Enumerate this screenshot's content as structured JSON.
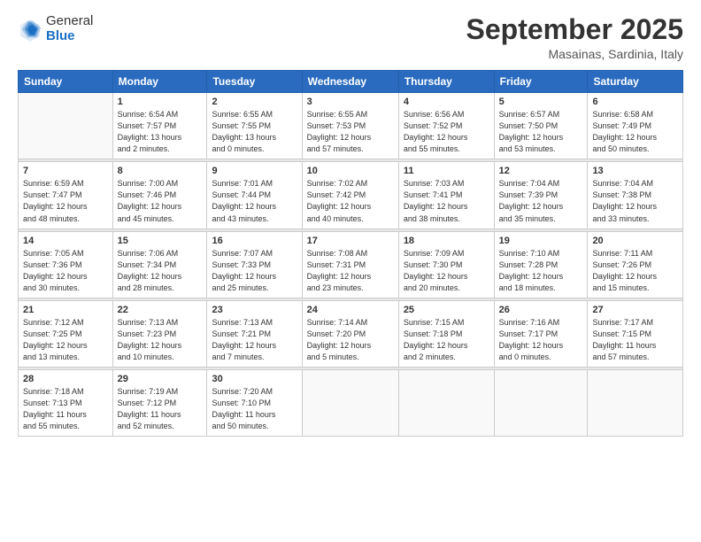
{
  "logo": {
    "general": "General",
    "blue": "Blue"
  },
  "header": {
    "month_title": "September 2025",
    "subtitle": "Masainas, Sardinia, Italy"
  },
  "weekdays": [
    "Sunday",
    "Monday",
    "Tuesday",
    "Wednesday",
    "Thursday",
    "Friday",
    "Saturday"
  ],
  "weeks": [
    [
      {
        "day": "",
        "info": ""
      },
      {
        "day": "1",
        "info": "Sunrise: 6:54 AM\nSunset: 7:57 PM\nDaylight: 13 hours\nand 2 minutes."
      },
      {
        "day": "2",
        "info": "Sunrise: 6:55 AM\nSunset: 7:55 PM\nDaylight: 13 hours\nand 0 minutes."
      },
      {
        "day": "3",
        "info": "Sunrise: 6:55 AM\nSunset: 7:53 PM\nDaylight: 12 hours\nand 57 minutes."
      },
      {
        "day": "4",
        "info": "Sunrise: 6:56 AM\nSunset: 7:52 PM\nDaylight: 12 hours\nand 55 minutes."
      },
      {
        "day": "5",
        "info": "Sunrise: 6:57 AM\nSunset: 7:50 PM\nDaylight: 12 hours\nand 53 minutes."
      },
      {
        "day": "6",
        "info": "Sunrise: 6:58 AM\nSunset: 7:49 PM\nDaylight: 12 hours\nand 50 minutes."
      }
    ],
    [
      {
        "day": "7",
        "info": "Sunrise: 6:59 AM\nSunset: 7:47 PM\nDaylight: 12 hours\nand 48 minutes."
      },
      {
        "day": "8",
        "info": "Sunrise: 7:00 AM\nSunset: 7:46 PM\nDaylight: 12 hours\nand 45 minutes."
      },
      {
        "day": "9",
        "info": "Sunrise: 7:01 AM\nSunset: 7:44 PM\nDaylight: 12 hours\nand 43 minutes."
      },
      {
        "day": "10",
        "info": "Sunrise: 7:02 AM\nSunset: 7:42 PM\nDaylight: 12 hours\nand 40 minutes."
      },
      {
        "day": "11",
        "info": "Sunrise: 7:03 AM\nSunset: 7:41 PM\nDaylight: 12 hours\nand 38 minutes."
      },
      {
        "day": "12",
        "info": "Sunrise: 7:04 AM\nSunset: 7:39 PM\nDaylight: 12 hours\nand 35 minutes."
      },
      {
        "day": "13",
        "info": "Sunrise: 7:04 AM\nSunset: 7:38 PM\nDaylight: 12 hours\nand 33 minutes."
      }
    ],
    [
      {
        "day": "14",
        "info": "Sunrise: 7:05 AM\nSunset: 7:36 PM\nDaylight: 12 hours\nand 30 minutes."
      },
      {
        "day": "15",
        "info": "Sunrise: 7:06 AM\nSunset: 7:34 PM\nDaylight: 12 hours\nand 28 minutes."
      },
      {
        "day": "16",
        "info": "Sunrise: 7:07 AM\nSunset: 7:33 PM\nDaylight: 12 hours\nand 25 minutes."
      },
      {
        "day": "17",
        "info": "Sunrise: 7:08 AM\nSunset: 7:31 PM\nDaylight: 12 hours\nand 23 minutes."
      },
      {
        "day": "18",
        "info": "Sunrise: 7:09 AM\nSunset: 7:30 PM\nDaylight: 12 hours\nand 20 minutes."
      },
      {
        "day": "19",
        "info": "Sunrise: 7:10 AM\nSunset: 7:28 PM\nDaylight: 12 hours\nand 18 minutes."
      },
      {
        "day": "20",
        "info": "Sunrise: 7:11 AM\nSunset: 7:26 PM\nDaylight: 12 hours\nand 15 minutes."
      }
    ],
    [
      {
        "day": "21",
        "info": "Sunrise: 7:12 AM\nSunset: 7:25 PM\nDaylight: 12 hours\nand 13 minutes."
      },
      {
        "day": "22",
        "info": "Sunrise: 7:13 AM\nSunset: 7:23 PM\nDaylight: 12 hours\nand 10 minutes."
      },
      {
        "day": "23",
        "info": "Sunrise: 7:13 AM\nSunset: 7:21 PM\nDaylight: 12 hours\nand 7 minutes."
      },
      {
        "day": "24",
        "info": "Sunrise: 7:14 AM\nSunset: 7:20 PM\nDaylight: 12 hours\nand 5 minutes."
      },
      {
        "day": "25",
        "info": "Sunrise: 7:15 AM\nSunset: 7:18 PM\nDaylight: 12 hours\nand 2 minutes."
      },
      {
        "day": "26",
        "info": "Sunrise: 7:16 AM\nSunset: 7:17 PM\nDaylight: 12 hours\nand 0 minutes."
      },
      {
        "day": "27",
        "info": "Sunrise: 7:17 AM\nSunset: 7:15 PM\nDaylight: 11 hours\nand 57 minutes."
      }
    ],
    [
      {
        "day": "28",
        "info": "Sunrise: 7:18 AM\nSunset: 7:13 PM\nDaylight: 11 hours\nand 55 minutes."
      },
      {
        "day": "29",
        "info": "Sunrise: 7:19 AM\nSunset: 7:12 PM\nDaylight: 11 hours\nand 52 minutes."
      },
      {
        "day": "30",
        "info": "Sunrise: 7:20 AM\nSunset: 7:10 PM\nDaylight: 11 hours\nand 50 minutes."
      },
      {
        "day": "",
        "info": ""
      },
      {
        "day": "",
        "info": ""
      },
      {
        "day": "",
        "info": ""
      },
      {
        "day": "",
        "info": ""
      }
    ]
  ]
}
